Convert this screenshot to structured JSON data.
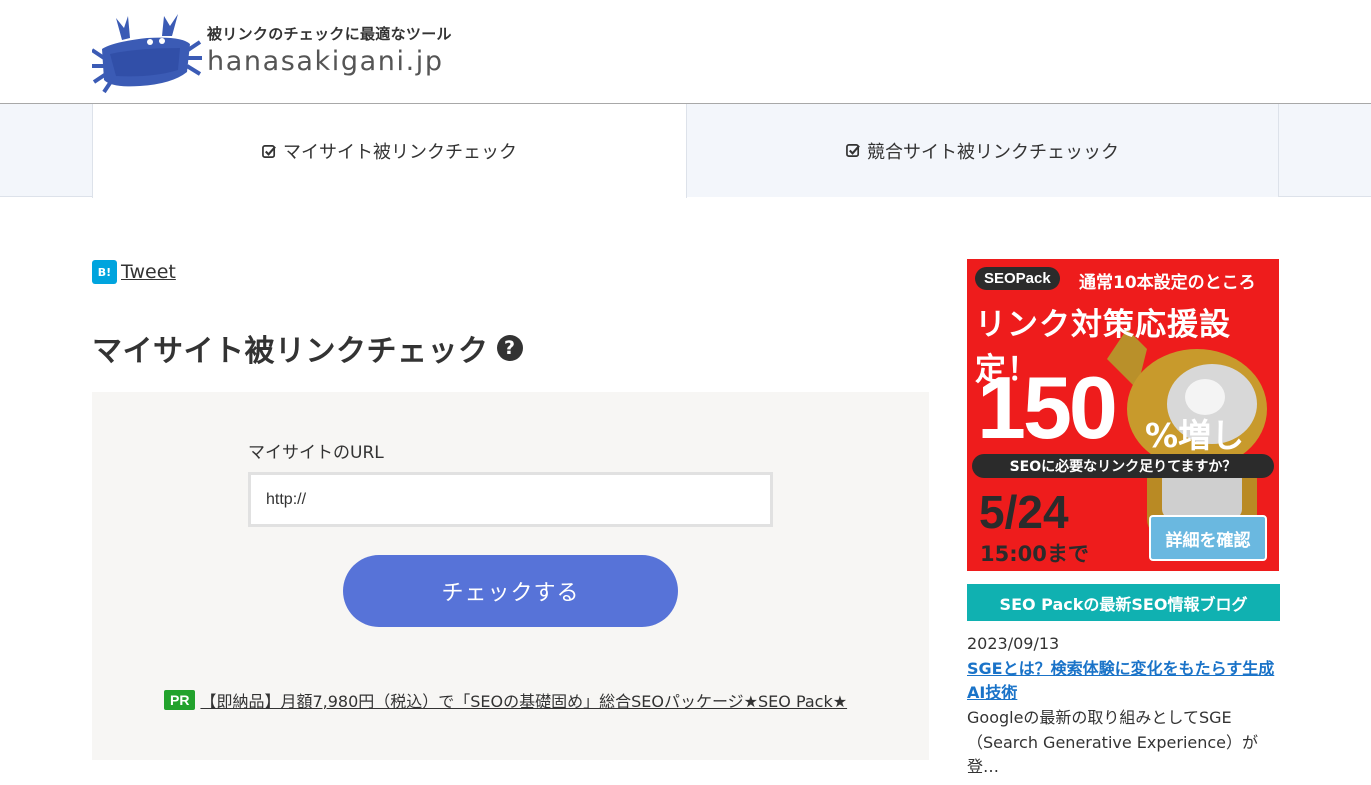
{
  "header": {
    "tagline": "被リンクのチェックに最適なツール",
    "site_name": "hanasakigani.jp"
  },
  "nav": {
    "tabs": [
      {
        "label": "マイサイト被リンクチェック",
        "active": true
      },
      {
        "label": "競合サイト被リンクチェッック",
        "active": false
      }
    ]
  },
  "share": {
    "hatena_label": "B!",
    "tweet_label": "Tweet"
  },
  "main": {
    "title": "マイサイト被リンクチェック",
    "help_icon": "?",
    "form": {
      "url_label": "マイサイトのURL",
      "url_value": "http://",
      "submit_label": "チェックする"
    },
    "pr": {
      "badge": "PR",
      "link_text": "【即納品】月額7,980円（税込）で「SEOの基礎固め」総合SEOパッケージ★SEO Pack★"
    }
  },
  "sidebar": {
    "ad": {
      "logo": "SEOPack",
      "headline1": "通常10本設定のところ",
      "headline2": "リンク対策応援設定！",
      "big_number": "150",
      "percent_text": "%増し",
      "bar_text": "SEOに必要なリンク足りてますか？",
      "date": "5/24",
      "time": "15:00まで",
      "button": "詳細を確認"
    },
    "blog": {
      "header": "SEO Packの最新SEO情報ブログ",
      "date": "2023/09/13",
      "title": "SGEとは？検索体験に変化をもたらす生成AI技術",
      "excerpt": "Googleの最新の取り組みとしてSGE（Search Generative Experience）が登…"
    }
  },
  "colors": {
    "primary_button": "#5773d8",
    "blog_header": "#10b1b1",
    "ad_red": "#ee1c1c",
    "pr_badge": "#22a22c",
    "link_blue": "#1a73c8"
  }
}
